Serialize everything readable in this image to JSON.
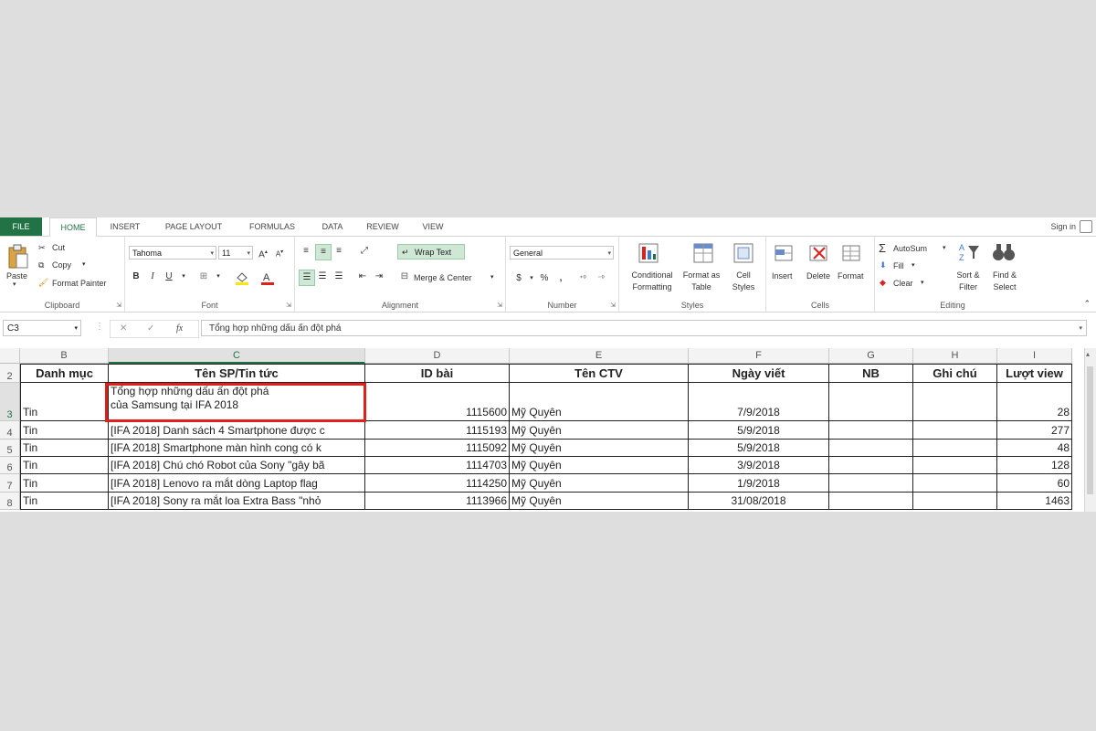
{
  "tabs": [
    "FILE",
    "HOME",
    "INSERT",
    "PAGE LAYOUT",
    "FORMULAS",
    "DATA",
    "REVIEW",
    "VIEW"
  ],
  "sign_in": "Sign in",
  "clipboard": {
    "paste": "Paste",
    "cut": "Cut",
    "copy": "Copy",
    "format_painter": "Format Painter",
    "label": "Clipboard"
  },
  "font": {
    "name": "Tahoma",
    "size": "11",
    "bold": "B",
    "italic": "I",
    "underline": "U",
    "label": "Font"
  },
  "alignment": {
    "wrap_text": "Wrap Text",
    "merge_center": "Merge & Center",
    "label": "Alignment"
  },
  "number": {
    "format": "General",
    "currency": "$",
    "percent": "%",
    "comma": ",",
    "label": "Number"
  },
  "styles": {
    "conditional": "Conditional Formatting",
    "format_table": "Format as Table",
    "cell_styles": "Cell Styles",
    "label": "Styles"
  },
  "cells": {
    "insert": "Insert",
    "delete": "Delete",
    "format": "Format",
    "label": "Cells"
  },
  "editing": {
    "autosum": "AutoSum",
    "fill": "Fill",
    "clear": "Clear",
    "sort_filter": "Sort & Filter",
    "find_select": "Find & Select",
    "label": "Editing"
  },
  "formula_bar": {
    "name_box": "C3",
    "fx": "fx",
    "content": "Tổng hợp những dấu ấn đột phá"
  },
  "columns": [
    "B",
    "C",
    "D",
    "E",
    "F",
    "G",
    "H",
    "I"
  ],
  "selected_column": "C",
  "header_row": {
    "row": "2",
    "cells": [
      "Danh mục",
      "Tên SP/Tin tức",
      "ID bài",
      "Tên CTV",
      "Ngày viết",
      "NB",
      "Ghi chú",
      "Lượt view"
    ]
  },
  "rows": [
    {
      "row": "3",
      "cells": [
        "Tin",
        "Tổng hợp những dấu ấn đột phá\ncủa Samsung tại IFA 2018",
        "1115600",
        "Mỹ Quyên",
        "7/9/2018",
        "",
        "",
        "28"
      ]
    },
    {
      "row": "4",
      "cells": [
        "Tin",
        "[IFA 2018] Danh sách 4 Smartphone được c",
        "1115193",
        "Mỹ Quyên",
        "5/9/2018",
        "",
        "",
        "277"
      ]
    },
    {
      "row": "5",
      "cells": [
        "Tin",
        "[IFA 2018] Smartphone màn hình cong có k",
        "1115092",
        "Mỹ Quyên",
        "5/9/2018",
        "",
        "",
        "48"
      ]
    },
    {
      "row": "6",
      "cells": [
        "Tin",
        "[IFA 2018] Chú chó Robot của Sony \"gây bã",
        "1114703",
        "Mỹ Quyên",
        "3/9/2018",
        "",
        "",
        "128"
      ]
    },
    {
      "row": "7",
      "cells": [
        "Tin",
        "[IFA 2018] Lenovo ra mắt dòng Laptop flag",
        "1114250",
        "Mỹ Quyên",
        "1/9/2018",
        "",
        "",
        "60"
      ]
    },
    {
      "row": "8",
      "cells": [
        "Tin",
        "[IFA 2018] Sony ra mắt loa Extra Bass \"nhỏ",
        "1113966",
        "Mỹ Quyên",
        "31/08/2018",
        "",
        "",
        "1463"
      ]
    }
  ],
  "colors": {
    "accent": "#217346",
    "highlight": "#e0201a"
  }
}
